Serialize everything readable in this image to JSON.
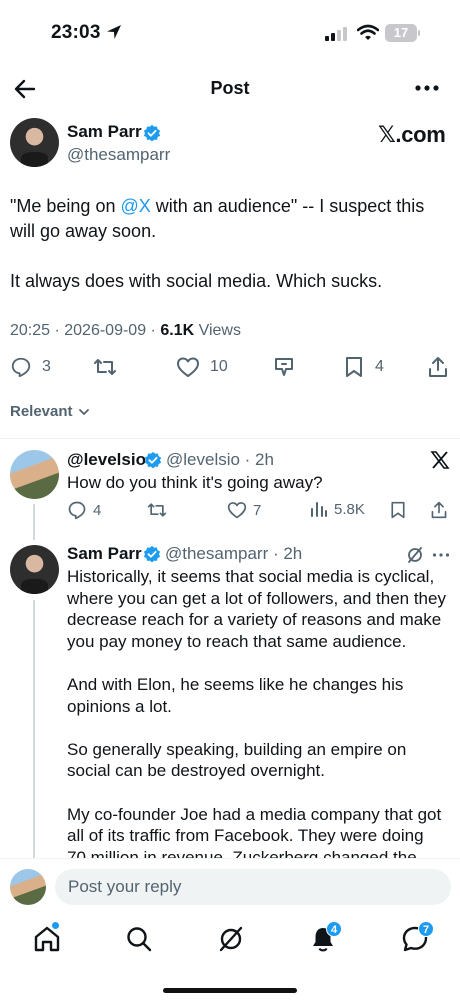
{
  "status_bar": {
    "time": "23:03",
    "battery": "17"
  },
  "nav": {
    "title": "Post"
  },
  "post": {
    "author_name": "Sam Parr",
    "author_handle": "@thesamparr",
    "brand": "𝕏.com",
    "text_before_mention": "\"Me being on ",
    "mention": "@X",
    "text_after_mention": " with an audience\" -- I suspect this will go away soon.",
    "text_second": "It always does with social media. Which sucks.",
    "meta_time": "20:25 · 2026-09-09 · ",
    "views_count": "6.1K",
    "views_label": " Views",
    "replies": "3",
    "likes": "10",
    "bookmarks": "4"
  },
  "sort": {
    "label": "Relevant"
  },
  "reply": {
    "author_name": "@levelsio",
    "author_handle": "@levelsio · 2h",
    "text": "How do you think it's going away?",
    "replies": "4",
    "likes": "7",
    "views": "5.8K"
  },
  "reply2": {
    "author_name": "Sam Parr",
    "author_handle": "@thesamparr · 2h",
    "paragraphs": [
      "Historically, it seems that social media is cyclical, where you can get a lot of followers, and then they decrease reach for a variety of reasons and make you pay money to reach that same audience.",
      "And with Elon, he seems like he changes his opinions a lot.",
      "So generally speaking, building an empire on social can be destroyed overnight.",
      "My co-founder Joe had a media company that got all of its traffic from Facebook. They were doing 70 million in revenue. Zuckerberg changed the"
    ]
  },
  "composer": {
    "placeholder": "Post your reply"
  },
  "tabbar": {
    "notifications_badge": "4",
    "messages_badge": "7"
  },
  "colors": {
    "accent": "#1d9bf0",
    "text": "#0f1419",
    "secondary": "#536471"
  }
}
